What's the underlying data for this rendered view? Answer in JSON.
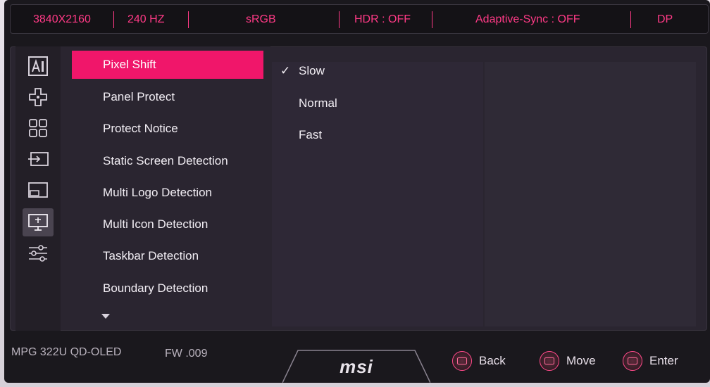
{
  "status_bar": {
    "resolution": "3840X2160",
    "refresh_rate": "240 HZ",
    "color_mode": "sRGB",
    "hdr": "HDR : OFF",
    "adaptive_sync": "Adaptive-Sync : OFF",
    "input": "DP"
  },
  "nav_icons": [
    "ai-icon",
    "gamepad-icon",
    "apps-grid-icon",
    "input-source-icon",
    "pip-icon",
    "oled-care-icon",
    "settings-sliders-icon"
  ],
  "active_nav": "oled-care-icon",
  "menu": {
    "items": [
      {
        "label": "Pixel Shift",
        "active": true
      },
      {
        "label": "Panel Protect",
        "active": false
      },
      {
        "label": "Protect Notice",
        "active": false
      },
      {
        "label": "Static Screen Detection",
        "active": false
      },
      {
        "label": "Multi Logo Detection",
        "active": false
      },
      {
        "label": "Multi Icon Detection",
        "active": false
      },
      {
        "label": "Taskbar Detection",
        "active": false
      },
      {
        "label": "Boundary Detection",
        "active": false
      }
    ]
  },
  "options": {
    "items": [
      {
        "label": "Slow",
        "selected": true
      },
      {
        "label": "Normal",
        "selected": false
      },
      {
        "label": "Fast",
        "selected": false
      }
    ]
  },
  "footer": {
    "model": "MPG 322U QD-OLED",
    "firmware": "FW .009",
    "brand": "msi",
    "back_label": "Back",
    "move_label": "Move",
    "enter_label": "Enter"
  },
  "colors": {
    "accent": "#f0166a",
    "status_text": "#ff3a86",
    "panel_bg": "#2a2530"
  }
}
